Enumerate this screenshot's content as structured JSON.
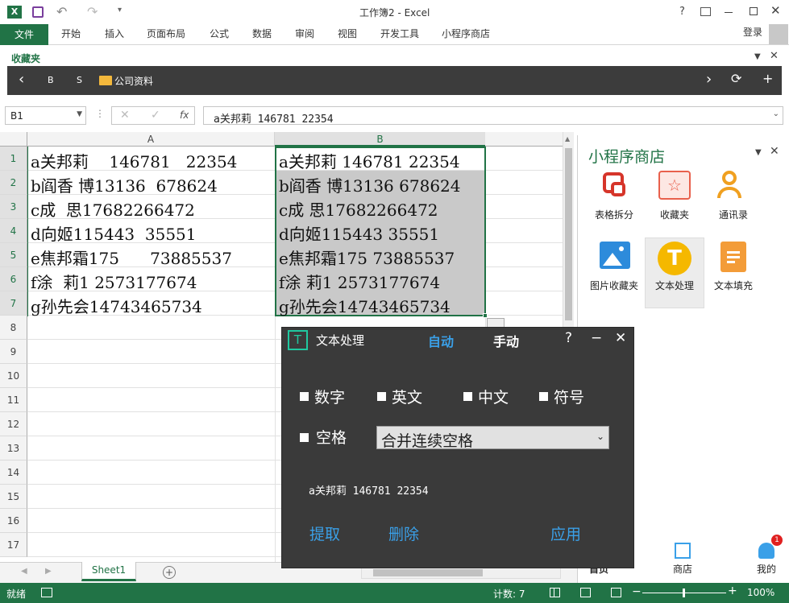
{
  "window": {
    "title": "工作簿2 - Excel",
    "help": "?",
    "signin": "登录"
  },
  "ribbon": {
    "tabs": [
      "文件",
      "开始",
      "插入",
      "页面布局",
      "公式",
      "数据",
      "审阅",
      "视图",
      "开发工具",
      "小程序商店"
    ]
  },
  "favorites": {
    "title": "收藏夹",
    "nav_back": "‹",
    "nav_b": "B",
    "nav_s": "S",
    "folder": "公司资料",
    "forward": "›",
    "refresh": "⟳",
    "add": "+"
  },
  "formula_bar": {
    "name_box": "B1",
    "fx": "fx",
    "value": "a关邦莉 146781 22354"
  },
  "sheet": {
    "col_a": "A",
    "col_b": "B",
    "rows": [
      "1",
      "2",
      "3",
      "4",
      "5",
      "6",
      "7",
      "8",
      "9",
      "10",
      "11",
      "12",
      "13",
      "14",
      "15",
      "16",
      "17"
    ],
    "col_a_values": [
      "a关邦莉    146781   22354",
      "b阎香 博13136  678624",
      "c成  思17682266472",
      "d向姬115443  35551",
      "e焦邦霜175      73885537",
      "f涂  莉1 2573177674",
      "g孙先会14743465734"
    ],
    "col_b_values": [
      "a关邦莉 146781 22354",
      "b阎香 博13136 678624",
      "c成 思17682266472",
      "d向姬115443 35551",
      "e焦邦霜175 73885537",
      "f涂 莉1 2573177674",
      "g孙先会14743465734"
    ],
    "tab": "Sheet1"
  },
  "panel": {
    "title": "小程序商店",
    "apps": [
      "表格拆分",
      "收藏夹",
      "通讯录",
      "图片收藏夹",
      "文本处理",
      "文本填充"
    ],
    "nav": [
      "首页",
      "商店",
      "我的"
    ],
    "badge": "1"
  },
  "dialog": {
    "title": "文本处理",
    "tab_auto": "自动",
    "tab_manual": "手动",
    "help": "?",
    "minimize": "−",
    "close": "✕",
    "options": [
      "数字",
      "英文",
      "中文",
      "符号"
    ],
    "space_label": "空格",
    "space_select": "合并连续空格",
    "preview": "a关邦莉 146781 22354",
    "extract": "提取",
    "delete": "删除",
    "apply": "应用"
  },
  "status": {
    "ready": "就绪",
    "count": "计数: 7",
    "zoom": "100%"
  },
  "colors": {
    "excel_green": "#217346",
    "dialog_bg": "#3a3a3a",
    "link_blue": "#3aa0e8",
    "panel_title": "#217346"
  }
}
